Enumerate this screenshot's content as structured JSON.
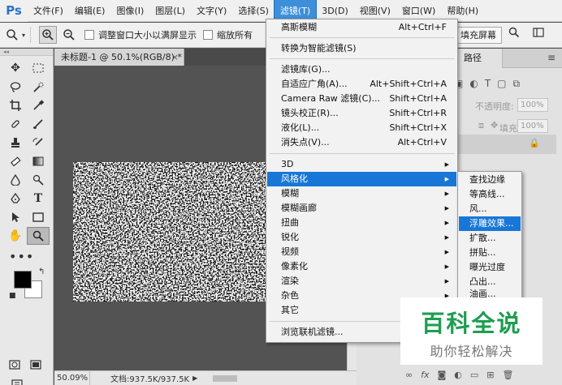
{
  "app": {
    "logo": "Ps"
  },
  "menubar": {
    "items": [
      {
        "label": "文件(F)"
      },
      {
        "label": "编辑(E)"
      },
      {
        "label": "图像(I)"
      },
      {
        "label": "图层(L)"
      },
      {
        "label": "文字(Y)"
      },
      {
        "label": "选择(S)"
      },
      {
        "label": "滤镜(T)",
        "active": true
      },
      {
        "label": "3D(D)"
      },
      {
        "label": "视图(V)"
      },
      {
        "label": "窗口(W)"
      },
      {
        "label": "帮助(H)"
      }
    ]
  },
  "options_bar": {
    "zoom_tool_icon": "zoom-icon",
    "resize_windows_label": "调整窗口大小以满屏显示",
    "zoom_all_label": "缩放所有",
    "fill_screen_label": "填充屏幕",
    "search_icon": "search-icon",
    "workspace_icon": "workspace-icon"
  },
  "document": {
    "tab_title": "未标题-1 @ 50.1%(RGB/8) *",
    "close_glyph": "×",
    "zoom": "50.09%",
    "doc_size": "文档:937.5K/937.5K"
  },
  "panels": {
    "paths_tab_label": "路径",
    "opacity_label": "不透明度:",
    "opacity_value": "100%",
    "lock_label": "锁定:",
    "fill_label": "填充:",
    "fill_value": "100%"
  },
  "filter_menu": {
    "items": [
      {
        "label": "高斯模糊",
        "shortcut": "Alt+Ctrl+F"
      },
      {
        "label": "转换为智能滤镜(S)"
      },
      {
        "label": "滤镜库(G)..."
      },
      {
        "label": "自适应广角(A)...",
        "shortcut": "Alt+Shift+Ctrl+A"
      },
      {
        "label": "Camera Raw 滤镜(C)...",
        "shortcut": "Shift+Ctrl+A"
      },
      {
        "label": "镜头校正(R)...",
        "shortcut": "Shift+Ctrl+R"
      },
      {
        "label": "液化(L)...",
        "shortcut": "Shift+Ctrl+X"
      },
      {
        "label": "消失点(V)...",
        "shortcut": "Alt+Ctrl+V"
      },
      {
        "label": "3D",
        "submenu": true
      },
      {
        "label": "风格化",
        "submenu": true,
        "highlighted": true
      },
      {
        "label": "模糊",
        "submenu": true
      },
      {
        "label": "模糊画廊",
        "submenu": true
      },
      {
        "label": "扭曲",
        "submenu": true
      },
      {
        "label": "锐化",
        "submenu": true
      },
      {
        "label": "视频",
        "submenu": true
      },
      {
        "label": "像素化",
        "submenu": true
      },
      {
        "label": "渲染",
        "submenu": true
      },
      {
        "label": "杂色",
        "submenu": true
      },
      {
        "label": "其它",
        "submenu": true
      },
      {
        "label": "浏览联机滤镜..."
      }
    ]
  },
  "stylize_submenu": {
    "items": [
      {
        "label": "查找边缘"
      },
      {
        "label": "等高线..."
      },
      {
        "label": "风..."
      },
      {
        "label": "浮雕效果...",
        "highlighted": true
      },
      {
        "label": "扩散..."
      },
      {
        "label": "拼贴..."
      },
      {
        "label": "曝光过度"
      },
      {
        "label": "凸出..."
      },
      {
        "label": "油画..."
      }
    ]
  },
  "watermark": {
    "title": "百科全说",
    "subtitle": "助你轻松解决"
  },
  "colors": {
    "accent": "#1877d6",
    "watermark_green": "#1e9e50",
    "foreground": "#000000",
    "background": "#ffffff"
  }
}
